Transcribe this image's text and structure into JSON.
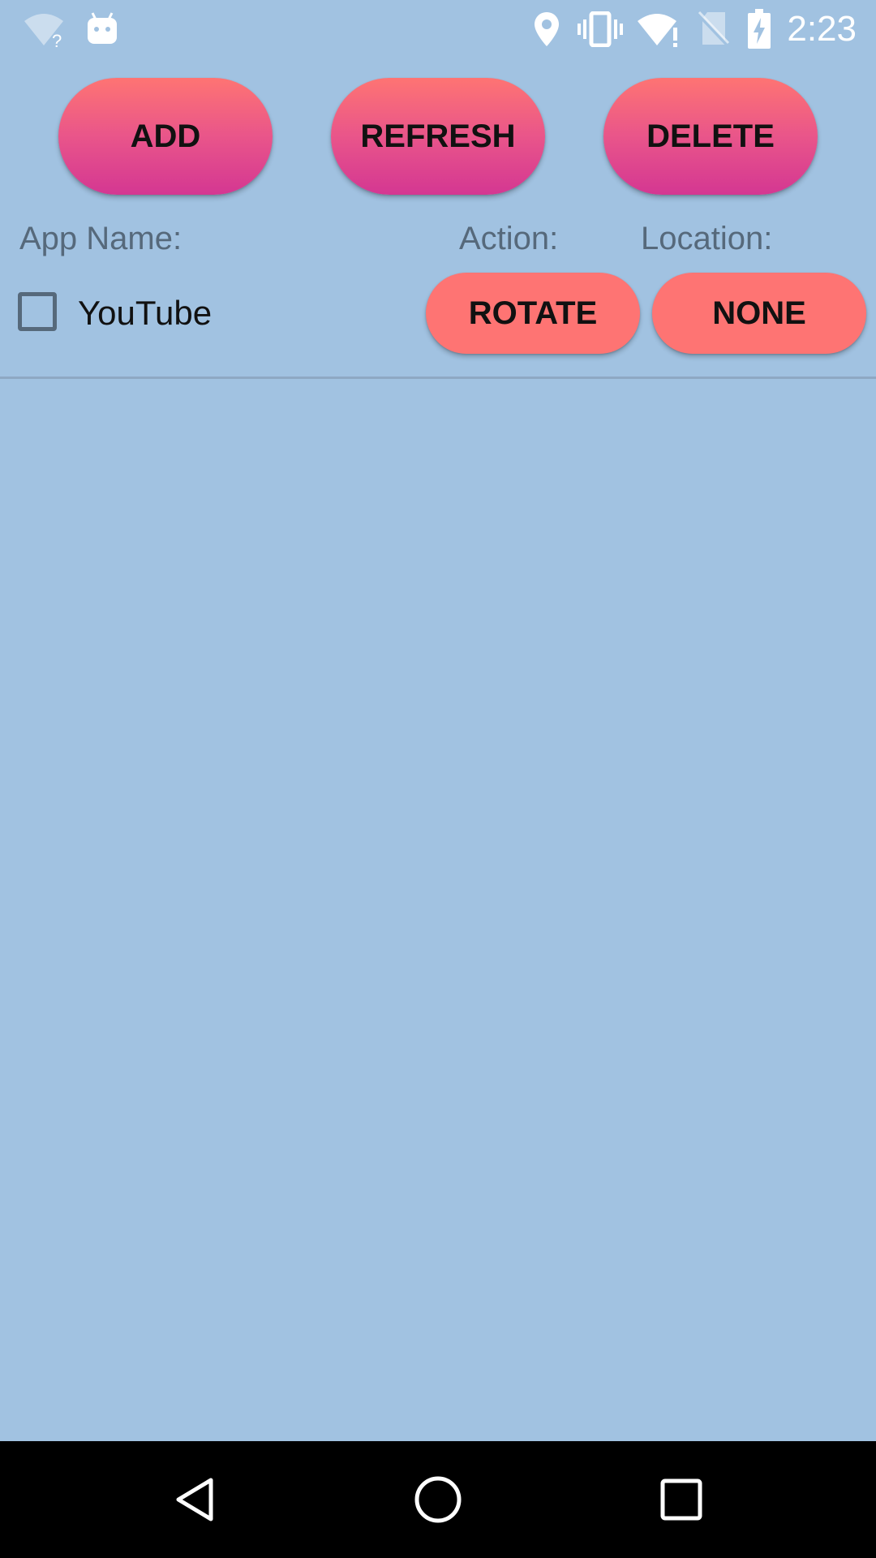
{
  "status_bar": {
    "time": "2:23",
    "icons": [
      "wifi-unknown-icon",
      "android-debug-icon",
      "location-icon",
      "vibrate-icon",
      "wifi-alert-icon",
      "no-sim-icon",
      "battery-charging-icon"
    ],
    "icon_color": "#ffffff"
  },
  "toolbar": {
    "add_label": "ADD",
    "refresh_label": "REFRESH",
    "delete_label": "DELETE"
  },
  "columns": {
    "app_name": "App Name:",
    "action": "Action:",
    "location": "Location:"
  },
  "rows": [
    {
      "checked": false,
      "app_name": "YouTube",
      "action": "ROTATE",
      "location": "NONE"
    }
  ],
  "nav_bar": {
    "icons": [
      "back-icon",
      "home-icon",
      "recents-icon"
    ]
  },
  "colors": {
    "background": "#a1c2e1",
    "button_gradient_top": "#fe7473",
    "button_gradient_bottom": "#d43792",
    "row_button": "#fe7473",
    "label_text": "#56697b",
    "nav_bar": "#000000"
  }
}
